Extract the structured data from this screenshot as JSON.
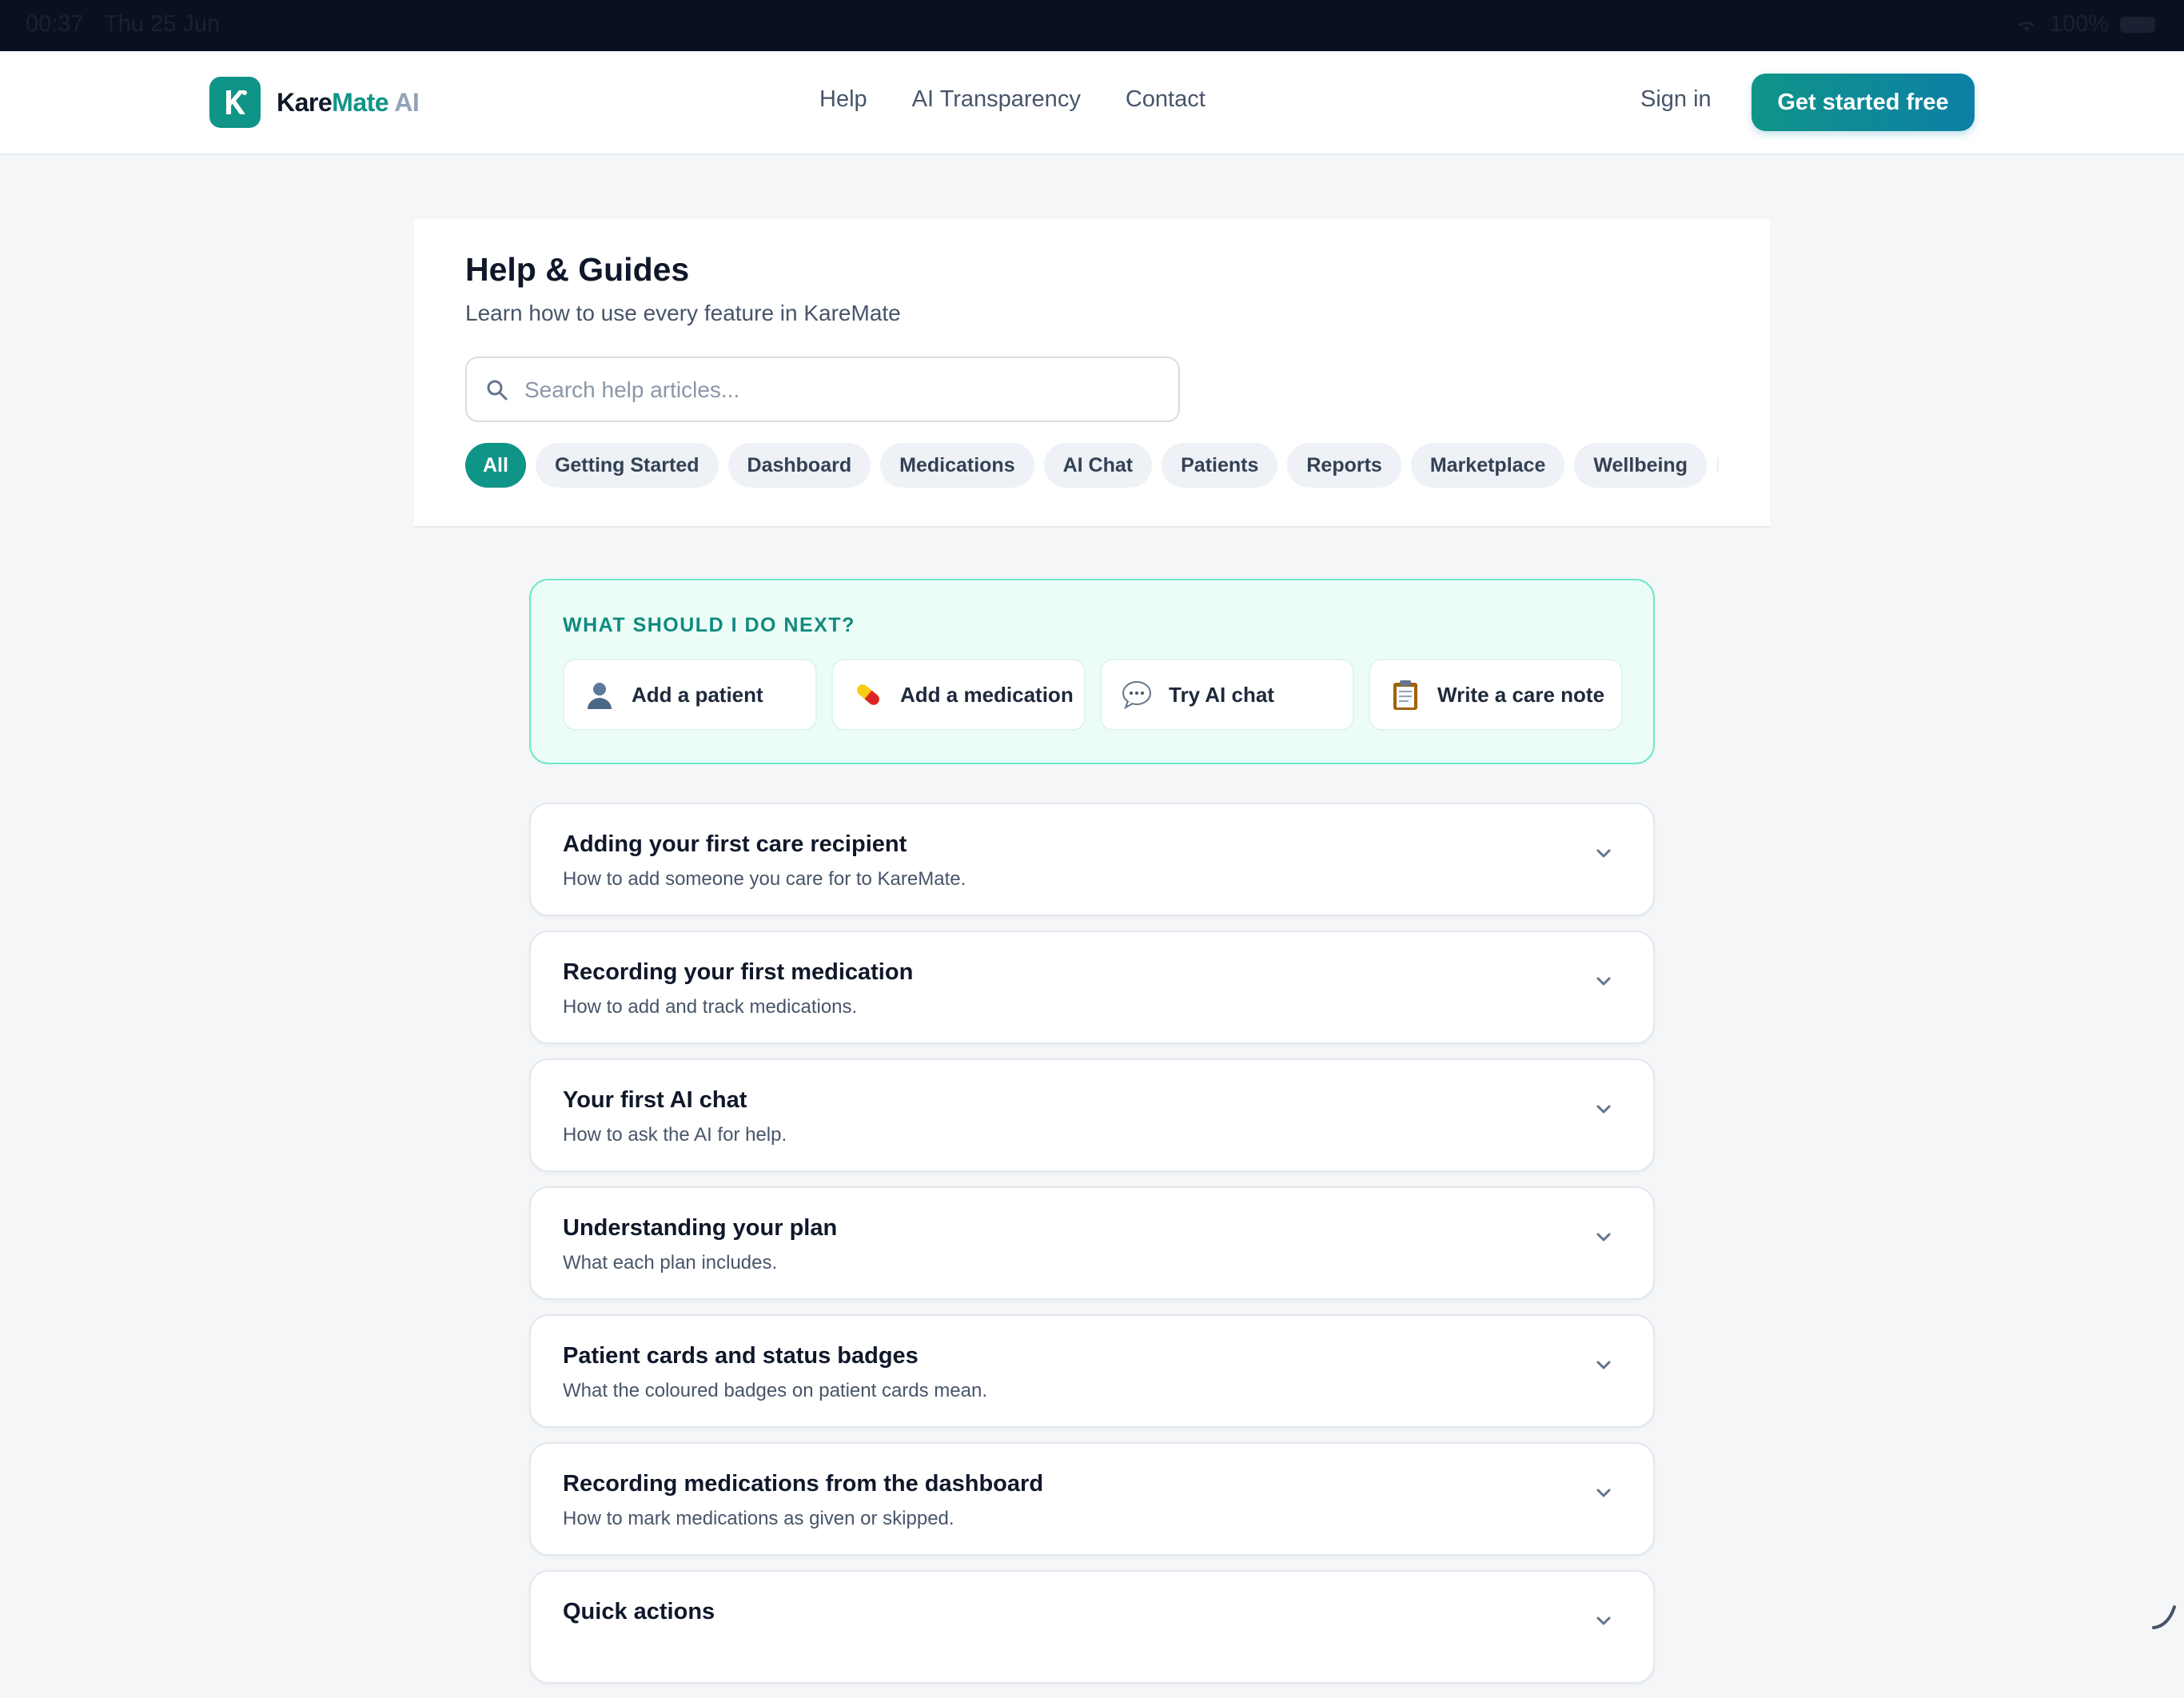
{
  "status_bar": {
    "time": "00:37",
    "date": "Thu 25 Jun",
    "battery": "100%"
  },
  "nav": {
    "brand": {
      "part1": "Kare",
      "part2": "Mate",
      "part3": " AI",
      "mark_letter": "K"
    },
    "links": [
      "Help",
      "AI Transparency",
      "Contact"
    ],
    "sign_in": "Sign in",
    "cta": "Get started free"
  },
  "header": {
    "title": "Help & Guides",
    "subtitle": "Learn how to use every feature in KareMate",
    "search_placeholder": "Search help articles...",
    "search_value": "",
    "categories": [
      "All",
      "Getting Started",
      "Dashboard",
      "Medications",
      "AI Chat",
      "Patients",
      "Reports",
      "Marketplace",
      "Wellbeing",
      ""
    ],
    "active_category": "All"
  },
  "next_steps": {
    "title": "WHAT SHOULD I DO NEXT?",
    "actions": [
      {
        "label": "Add a patient",
        "icon": "person-icon"
      },
      {
        "label": "Add a medication",
        "icon": "pill-icon"
      },
      {
        "label": "Try AI chat",
        "icon": "chat-bubble-icon"
      },
      {
        "label": "Write a care note",
        "icon": "clipboard-icon"
      }
    ]
  },
  "articles": [
    {
      "title": "Adding your first care recipient",
      "desc": "How to add someone you care for to KareMate."
    },
    {
      "title": "Recording your first medication",
      "desc": "How to add and track medications."
    },
    {
      "title": "Your first AI chat",
      "desc": "How to ask the AI for help."
    },
    {
      "title": "Understanding your plan",
      "desc": "What each plan includes."
    },
    {
      "title": "Patient cards and status badges",
      "desc": "What the coloured badges on patient cards mean."
    },
    {
      "title": "Recording medications from the dashboard",
      "desc": "How to mark medications as given or skipped."
    },
    {
      "title": "Quick actions",
      "desc": ""
    }
  ],
  "colors": {
    "brand": "#0f9488",
    "accent_border": "#6ee7c8",
    "statusbar": "#0b1020"
  }
}
